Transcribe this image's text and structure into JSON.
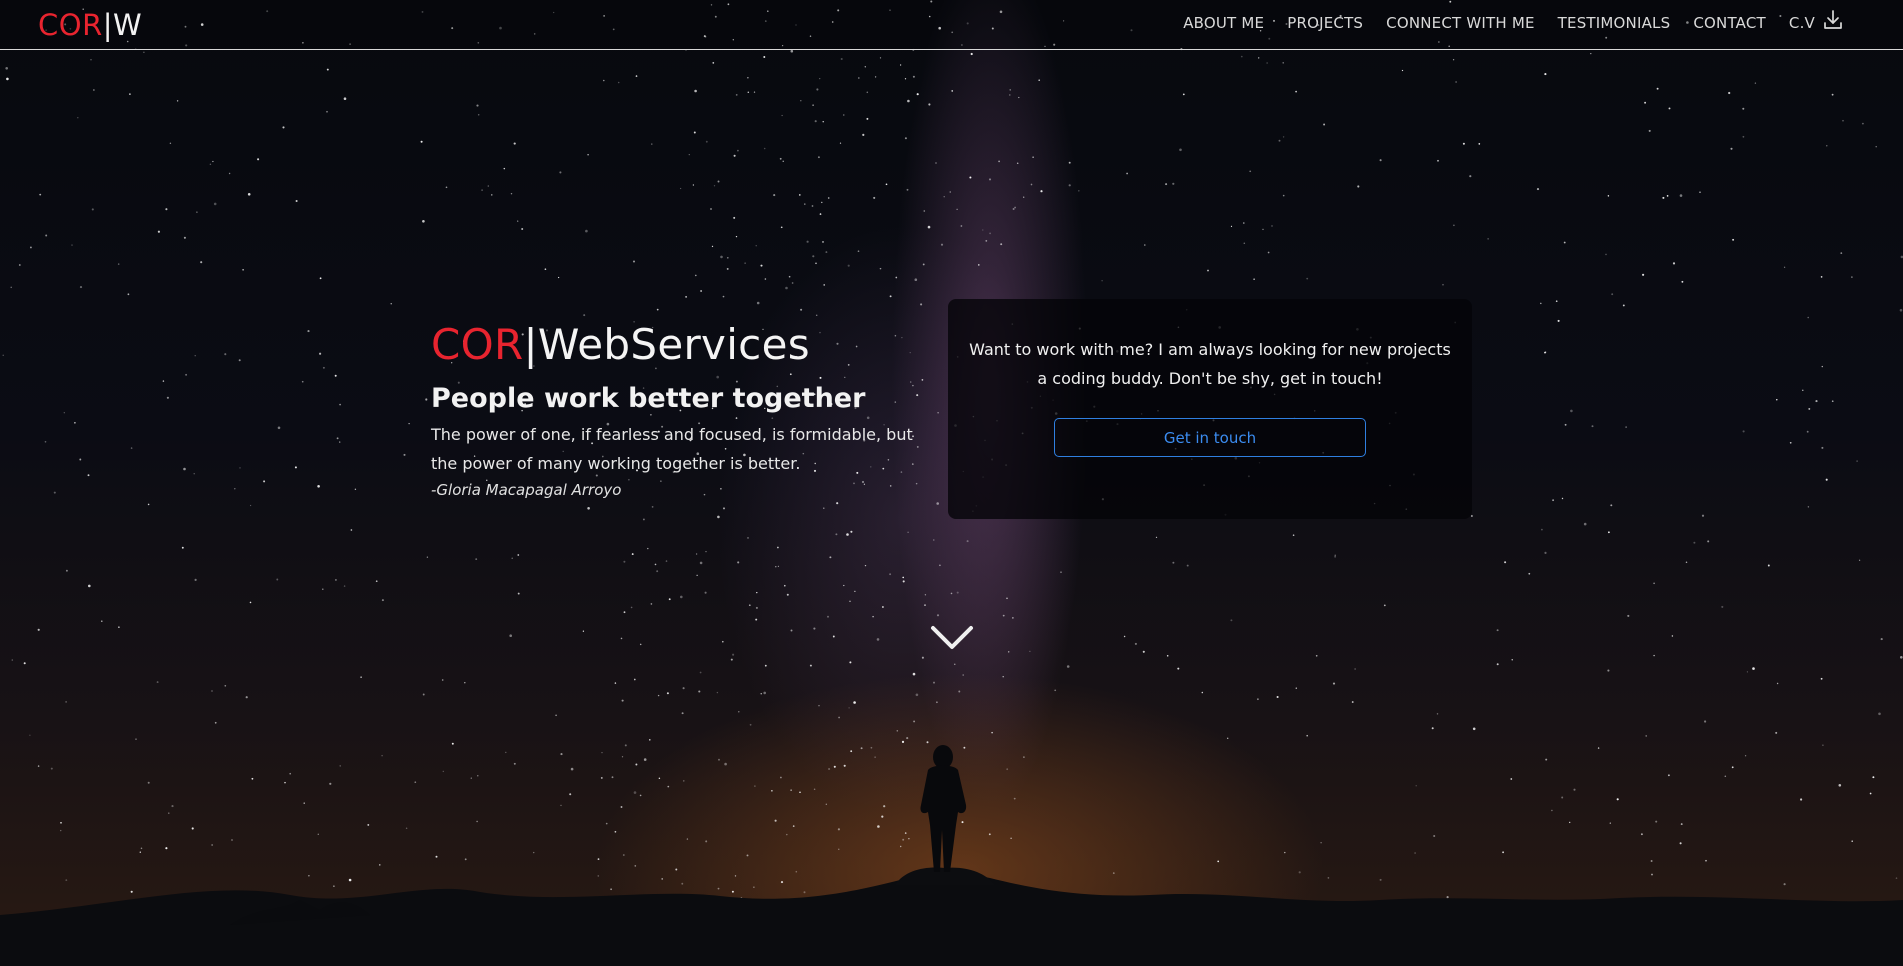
{
  "navbar": {
    "brand": {
      "accent": "COR",
      "rest": "|W"
    },
    "links": [
      {
        "label": "ABOUT ME"
      },
      {
        "label": "PROJECTS"
      },
      {
        "label": "CONNECT WITH ME"
      },
      {
        "label": "TESTIMONIALS"
      },
      {
        "label": "CONTACT"
      }
    ],
    "cv": {
      "label": "C.V",
      "icon": "download-icon"
    }
  },
  "intro": {
    "title_accent": "COR",
    "title_rest": "|WebServices",
    "tagline": "People work better together",
    "quote": "The power of one, if fearless and focused, is formidable, but the power of many working together is better.",
    "author": "-Gloria Macapagal Arroyo"
  },
  "card": {
    "text": "Want to work with me? I am always looking for new projects a coding buddy. Don't be shy, get in touch!",
    "button_label": "Get in touch"
  },
  "scroll": {
    "icon": "chevron-down-icon"
  },
  "colors": {
    "accent": "#e8242f",
    "button": "#2f7fe0",
    "text": "#f2f2f2"
  }
}
